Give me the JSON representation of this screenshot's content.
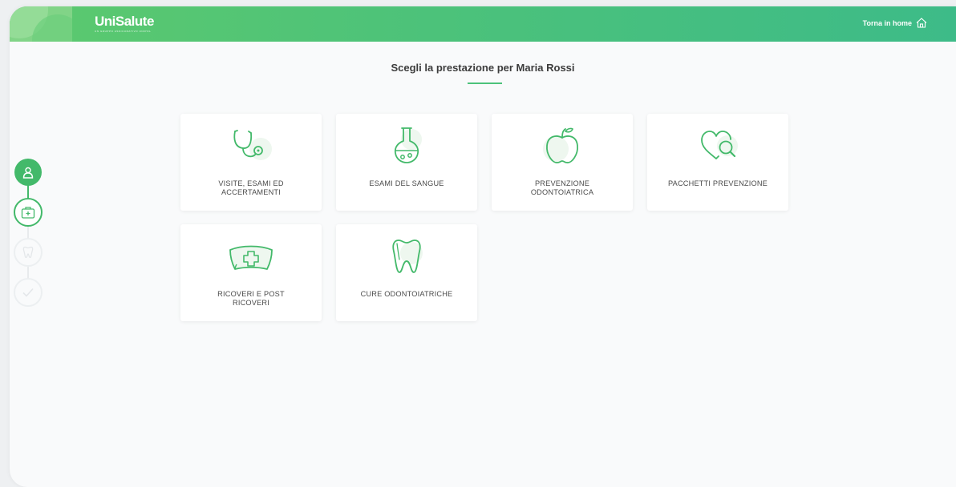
{
  "header": {
    "logo_text": "UniSalute",
    "logo_tagline": "UN GRUPPO ASSICURATIVO UNIPOL",
    "home_label": "Torna in home"
  },
  "page": {
    "title": "Scegli la prestazione per Maria Rossi"
  },
  "cards": [
    {
      "label_line1": "VISITE, ESAMI ED",
      "label_line2": "ACCERTAMENTI",
      "icon": "stethoscope-icon"
    },
    {
      "label_line1": "ESAMI DEL SANGUE",
      "label_line2": "",
      "icon": "flask-icon"
    },
    {
      "label_line1": "PREVENZIONE",
      "label_line2": "ODONTOIATRICA",
      "icon": "apple-icon"
    },
    {
      "label_line1": "PACCHETTI PREVENZIONE",
      "label_line2": "",
      "icon": "heart-search-icon"
    },
    {
      "label_line1": "RICOVERI E POST",
      "label_line2": "RICOVERI",
      "icon": "nurse-cap-icon"
    },
    {
      "label_line1": "CURE ODONTOIATRICHE",
      "label_line2": "",
      "icon": "tooth-icon"
    }
  ],
  "stepper": {
    "steps": [
      {
        "icon": "user-icon",
        "state": "done"
      },
      {
        "icon": "medical-kit-icon",
        "state": "active"
      },
      {
        "icon": "tooth-icon",
        "state": "pending"
      },
      {
        "icon": "check-icon",
        "state": "pending"
      }
    ]
  },
  "colors": {
    "accent": "#4cc27a",
    "header_start": "#5cc96e",
    "header_end": "#3dbb88",
    "text": "#4a4a4a"
  }
}
